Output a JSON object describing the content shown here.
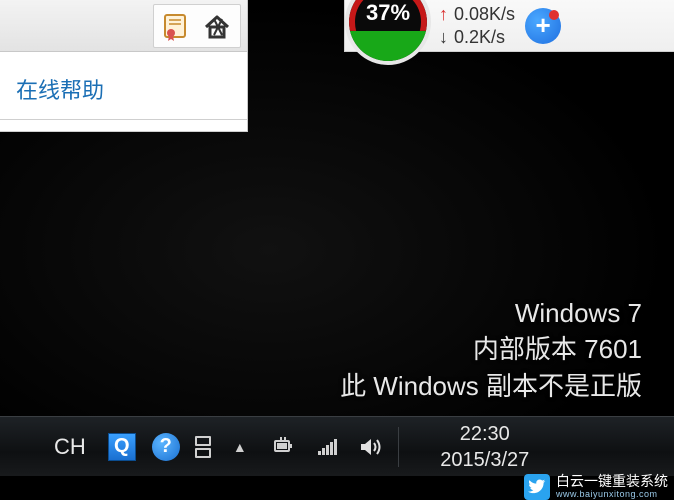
{
  "app_window": {
    "help_link": "在线帮助"
  },
  "net_widget": {
    "gauge_percent": "37%",
    "upload_speed": "0.08K/s",
    "download_speed": "0.2K/s"
  },
  "watermark": {
    "line1": "Windows 7",
    "line2": "内部版本 7601",
    "line3": "此 Windows 副本不是正版"
  },
  "taskbar": {
    "language": "CH",
    "q_label": "Q",
    "help_label": "?",
    "time": "22:30",
    "date": "2015/3/27"
  },
  "site_watermark": {
    "title": "白云一键重装系统",
    "url": "www.baiyunxitong.com"
  }
}
